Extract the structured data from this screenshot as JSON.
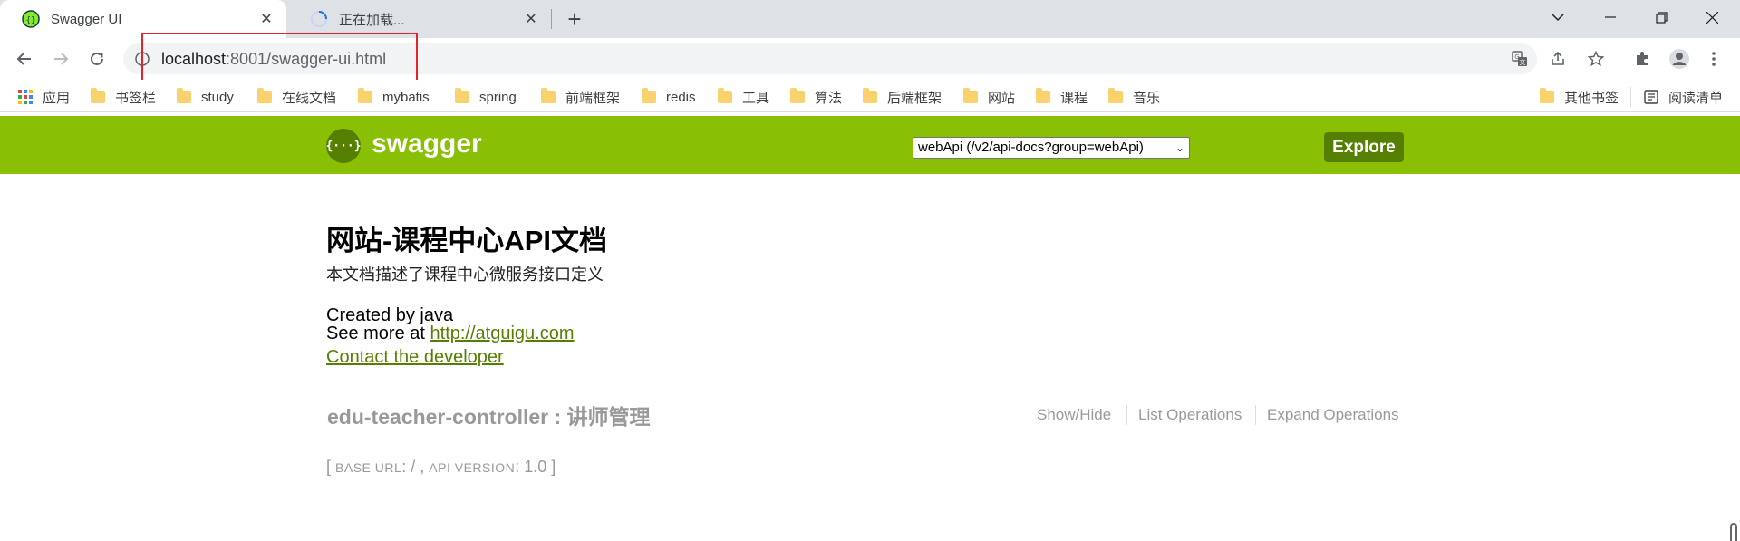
{
  "browser": {
    "tabs": [
      {
        "title": "Swagger UI",
        "active": true
      },
      {
        "title": "正在加载...",
        "active": false
      }
    ],
    "url": {
      "host": "localhost",
      "rest": ":8001/swagger-ui.html"
    },
    "bookmarks": [
      "应用",
      "书签栏",
      "study",
      "在线文档",
      "mybatis",
      "spring",
      "前端框架",
      "redis",
      "工具",
      "算法",
      "后端框架",
      "网站",
      "课程",
      "音乐"
    ],
    "bookmarks_right": [
      "其他书签",
      "阅读清单"
    ]
  },
  "swagger": {
    "brand": "swagger",
    "logo_glyph": "{···}",
    "spec_select": "webApi (/v2/api-docs?group=webApi)",
    "explore_label": "Explore"
  },
  "info": {
    "title": "网站-课程中心API文档",
    "description": "本文档描述了课程中心微服务接口定义",
    "created_by": "Created by java",
    "see_more_prefix": "See more at ",
    "see_more_link": "http://atguigu.com",
    "contact_link": "Contact the developer"
  },
  "resource": {
    "name": "edu-teacher-controller : 讲师管理",
    "actions": [
      "Show/Hide",
      "List Operations",
      "Expand Operations"
    ]
  },
  "footer": {
    "open": "[ ",
    "base_url_label": "BASE URL",
    "base_url_value": ": / , ",
    "api_version_label": "API VERSION",
    "api_version_value": ": 1.0 ",
    "close": "]"
  },
  "colors": {
    "swagger_green": "#89bf04",
    "swagger_dark_green": "#547f00",
    "highlight_red": "#e0262b"
  }
}
